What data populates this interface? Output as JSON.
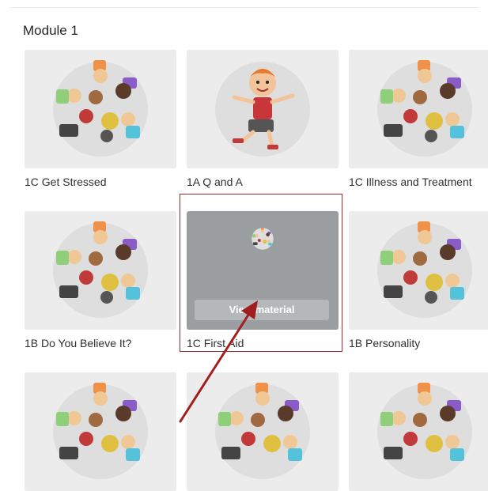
{
  "module": {
    "title": "Module 1"
  },
  "cards": [
    {
      "label": "1C Get Stressed",
      "image": "kids-circle"
    },
    {
      "label": "1A Q and A",
      "image": "boy-character"
    },
    {
      "label": "1C Illness and Treatment",
      "image": "kids-circle"
    },
    {
      "label": "1B Do You Believe It?",
      "image": "kids-circle"
    },
    {
      "label": "1C First Aid",
      "image": "kids-circle",
      "hover_button": "View material"
    },
    {
      "label": "1B Personality",
      "image": "kids-circle"
    },
    {
      "label": "",
      "image": "kids-circle"
    },
    {
      "label": "",
      "image": "kids-circle"
    },
    {
      "label": "",
      "image": "kids-circle"
    }
  ],
  "annotation": {
    "highlight_color": "#9b2a2a",
    "arrow_color": "#a01e1e"
  },
  "colors": {
    "card_bg": "#ececec",
    "circle_bg": "#dedede",
    "overlay": "#9a9ea1"
  }
}
